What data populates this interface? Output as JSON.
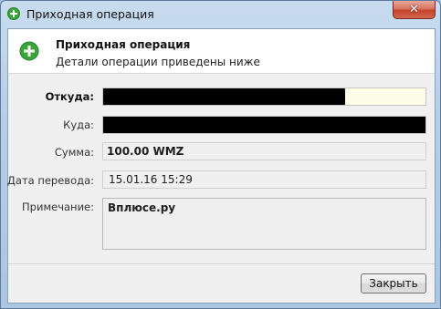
{
  "window": {
    "title": "Приходная операция",
    "close_glyph": "✕",
    "icon": "plus-circle-icon"
  },
  "header": {
    "title": "Приходная операция",
    "subtitle": "Детали операции приведены ниже",
    "icon": "plus-circle-icon"
  },
  "form": {
    "from_label": "Откуда:",
    "to_label": "Куда:",
    "amount_label": "Сумма:",
    "amount_value": "100.00 WMZ",
    "date_label": "Дата перевода:",
    "date_value": "15.01.16 15:29",
    "note_label": "Примечание:",
    "note_value": "Вплюсе.ру"
  },
  "buttons": {
    "close_label": "Закрыть"
  },
  "colors": {
    "icon_green": "#3aa53a",
    "redaction": "#000000",
    "from_field_bg": "#fdfde8"
  }
}
